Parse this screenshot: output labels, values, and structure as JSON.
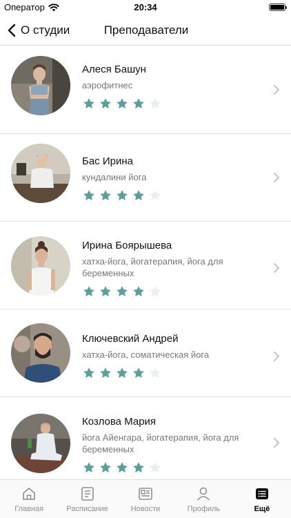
{
  "status_bar": {
    "carrier": "Оператор",
    "time": "20:34"
  },
  "nav": {
    "back_label": "О студии",
    "title": "Преподаватели"
  },
  "teachers": [
    {
      "name": "Алеся Башун",
      "specialty": "аэрофитнес",
      "rating": 4
    },
    {
      "name": "Бас Ирина",
      "specialty": "кундалини йога",
      "rating": 4
    },
    {
      "name": "Ирина Боярышева",
      "specialty": "хатха-йога, йогатерапия, йога для беременных",
      "rating": 4
    },
    {
      "name": "Ключевский Андрей",
      "specialty": "хатха-йога, соматическая йога",
      "rating": 4
    },
    {
      "name": "Козлова Мария",
      "specialty": "йога Айенгара, йогатерапия, йога для беременных",
      "rating": 4
    }
  ],
  "rating_max": 5,
  "colors": {
    "star_filled": "#5f9e9a",
    "star_empty": "#e8f0ef",
    "active_tab": "#000000"
  },
  "tabs": [
    {
      "label": "Главная",
      "icon": "home-icon",
      "active": false
    },
    {
      "label": "Расписание",
      "icon": "schedule-icon",
      "active": false
    },
    {
      "label": "Новости",
      "icon": "news-icon",
      "active": false
    },
    {
      "label": "Профиль",
      "icon": "profile-icon",
      "active": false
    },
    {
      "label": "Ещё",
      "icon": "more-icon",
      "active": true
    }
  ]
}
